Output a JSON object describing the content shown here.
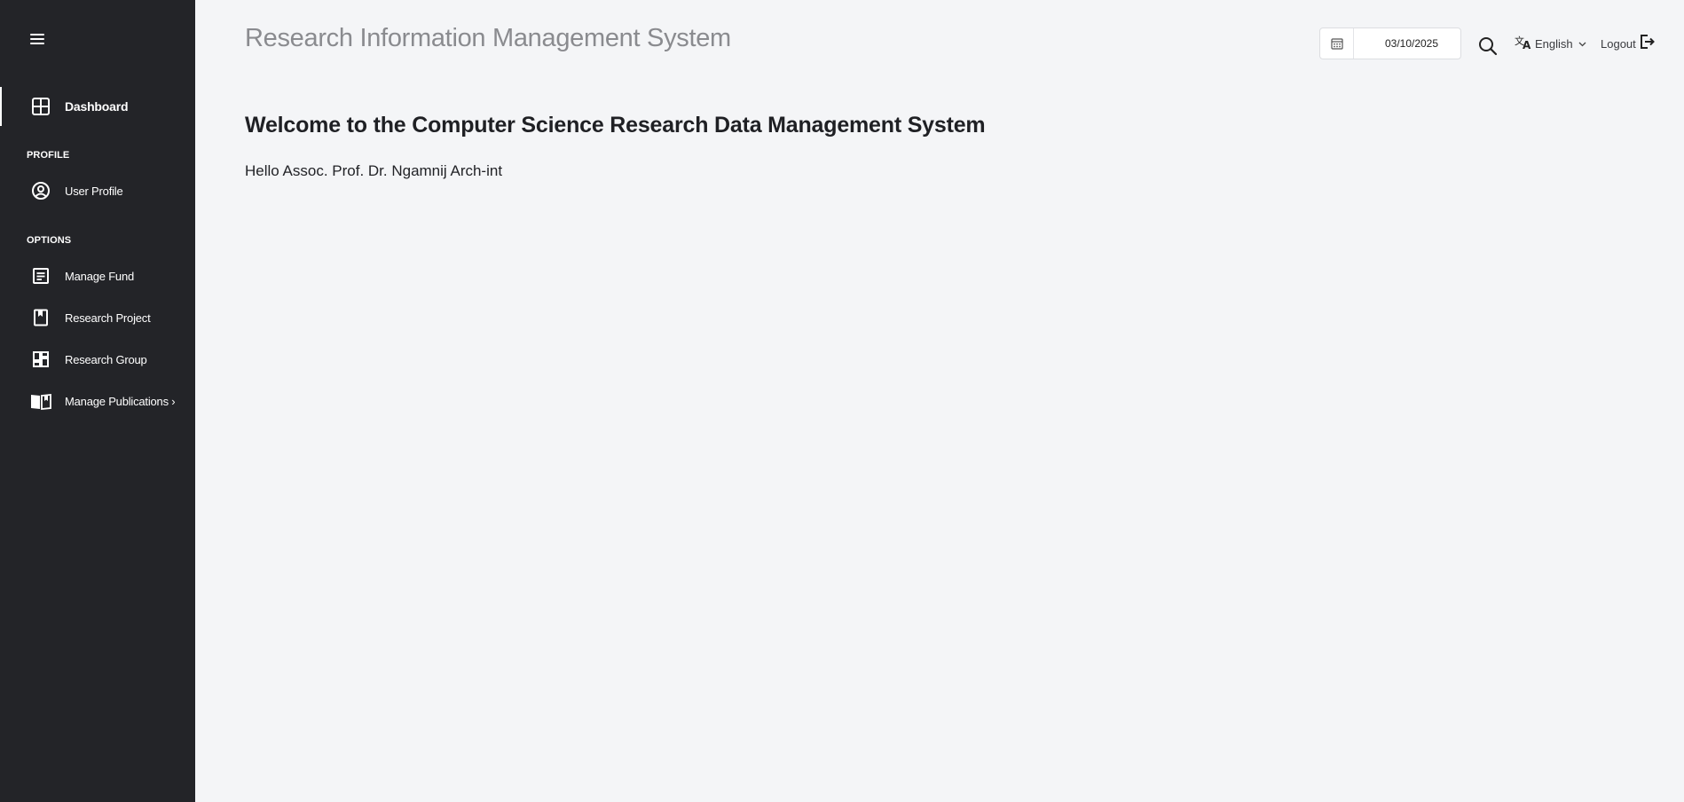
{
  "sidebar": {
    "menu_icon": "hamburger-menu-icon",
    "items": {
      "dashboard": {
        "label": "Dashboard",
        "icon": "dashboard-grid-icon"
      },
      "user_profile": {
        "label": "User Profile",
        "icon": "user-circle-icon"
      },
      "manage_fund": {
        "label": "Manage Fund",
        "icon": "document-list-icon"
      },
      "research_project": {
        "label": "Research Project",
        "icon": "bookmark-icon"
      },
      "research_group": {
        "label": "Research Group",
        "icon": "group-layout-icon"
      },
      "manage_publications": {
        "label": "Manage Publications ›",
        "icon": "open-book-icon"
      }
    },
    "sections": {
      "profile": "PROFILE",
      "options": "OPTIONS"
    }
  },
  "header": {
    "title": "Research Information Management System",
    "date_value": "03/10/2025",
    "language": "English",
    "logout_label": "Logout"
  },
  "main": {
    "welcome": "Welcome to the Computer Science Research Data Management System",
    "greeting": "Hello Assoc. Prof. Dr. Ngamnij Arch-int"
  },
  "colors": {
    "sidebar_bg": "#232428",
    "page_bg": "#f4f5f7",
    "title_gray": "#8a8b8f"
  }
}
